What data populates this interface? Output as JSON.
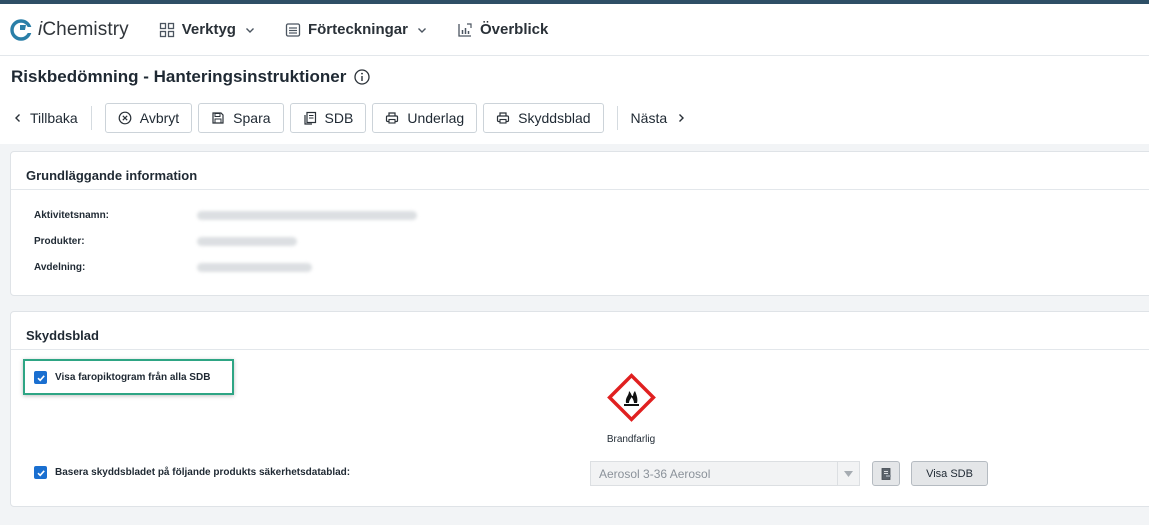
{
  "brand": {
    "name_prefix": "i",
    "name_rest": "Chemistry"
  },
  "nav": {
    "items": [
      {
        "label": "Verktyg",
        "icon": "grid-icon",
        "dropdown": true
      },
      {
        "label": "Förteckningar",
        "icon": "list-icon",
        "dropdown": true
      },
      {
        "label": "Överblick",
        "icon": "chart-icon",
        "dropdown": false
      }
    ]
  },
  "page": {
    "title": "Riskbedömning - Hanteringsinstruktioner"
  },
  "toolbar": {
    "back": "Tillbaka",
    "cancel": "Avbryt",
    "save": "Spara",
    "sdb": "SDB",
    "underlag": "Underlag",
    "skyddsblad": "Skyddsblad",
    "next": "Nästa"
  },
  "basic_info": {
    "title": "Grundläggande information",
    "rows": [
      {
        "label": "Aktivitetsnamn:",
        "value": ""
      },
      {
        "label": "Produkter:",
        "value": ""
      },
      {
        "label": "Avdelning:",
        "value": ""
      }
    ]
  },
  "skyddsblad": {
    "title": "Skyddsblad",
    "show_pictograms_label": "Visa faropiktogram från alla SDB",
    "show_pictograms_checked": true,
    "pictogram_label": "Brandfarlig",
    "base_label": "Basera skyddsbladet på följande produkts säkerhetsdatablad:",
    "base_checked": true,
    "product_select_value": "Aerosol 3-36 Aerosol",
    "visa_sdb": "Visa SDB"
  },
  "colors": {
    "accent": "#1a6fd0",
    "highlight": "#2ea584",
    "hazard_red": "#e02020",
    "top_stripe": "#2e4f66"
  }
}
